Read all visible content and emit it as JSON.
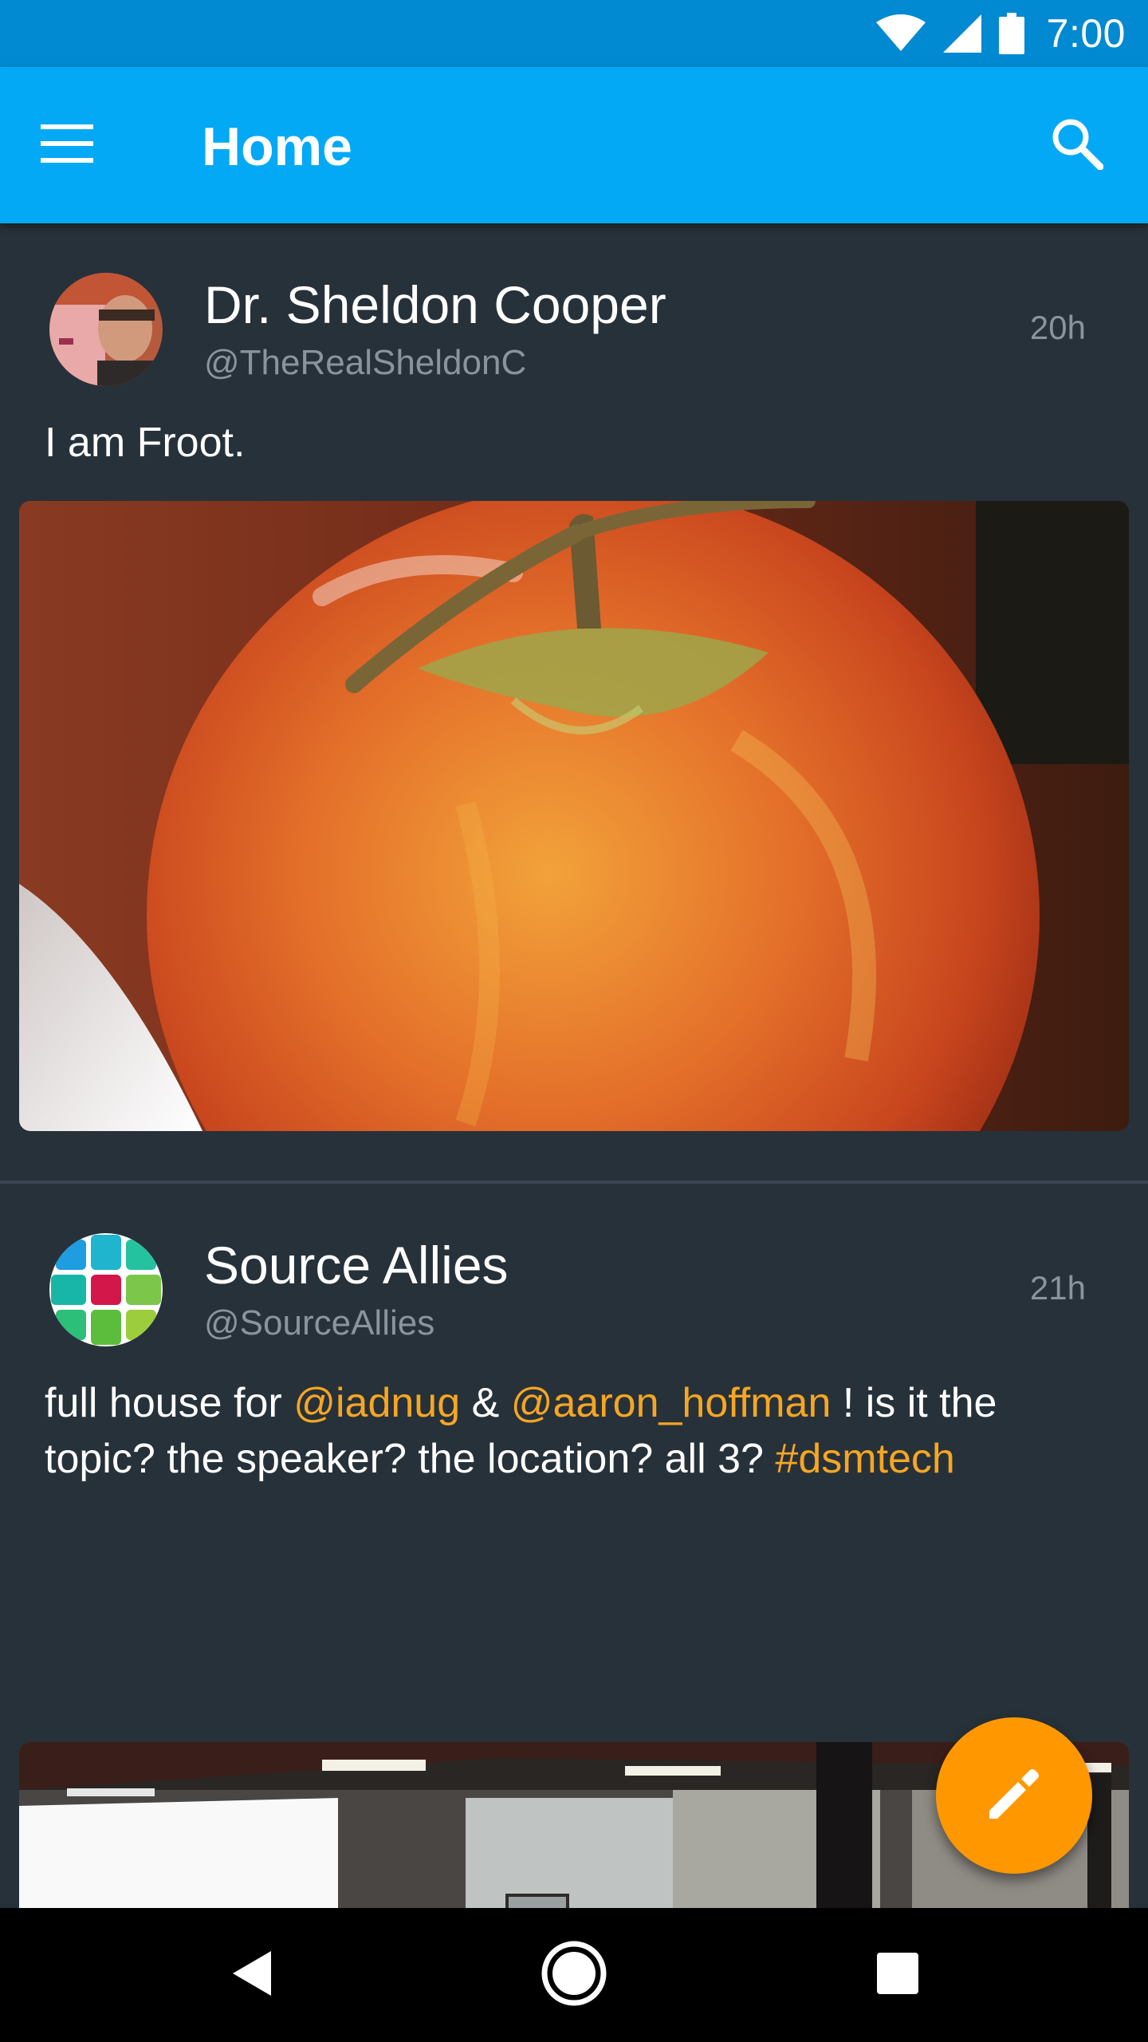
{
  "status_bar": {
    "time": "7:00",
    "icons": [
      "wifi-icon",
      "cell-signal-icon",
      "battery-icon"
    ]
  },
  "app_bar": {
    "title": "Home",
    "menu_icon": "hamburger-menu-icon",
    "search_icon": "search-icon"
  },
  "tweets": [
    {
      "name": "Dr. Sheldon Cooper",
      "handle": "@TheRealSheldonC",
      "time": "20h",
      "text": "I am Froot.",
      "media": "apple-photo"
    },
    {
      "name": "Source Allies",
      "handle": "@SourceAllies",
      "time": "21h",
      "text_parts": {
        "p1": "full house for ",
        "link1": "@iadnug",
        "p2": " & ",
        "link2": "@aaron_hoffman",
        "p3": " ! is it the topic? the speaker? the location? all 3? ",
        "link3": "#dsmtech"
      },
      "media": "conference-room-photo"
    }
  ],
  "fab": {
    "icon": "pencil-icon"
  },
  "nav_bar": {
    "icons": [
      "back-icon",
      "home-icon",
      "recents-icon"
    ]
  },
  "colors": {
    "status_bar": "#0189d1",
    "app_bar": "#03a9f4",
    "background": "#27313a",
    "link": "#f6a623",
    "fab": "#ff9800",
    "secondary_text": "#8a949c"
  }
}
